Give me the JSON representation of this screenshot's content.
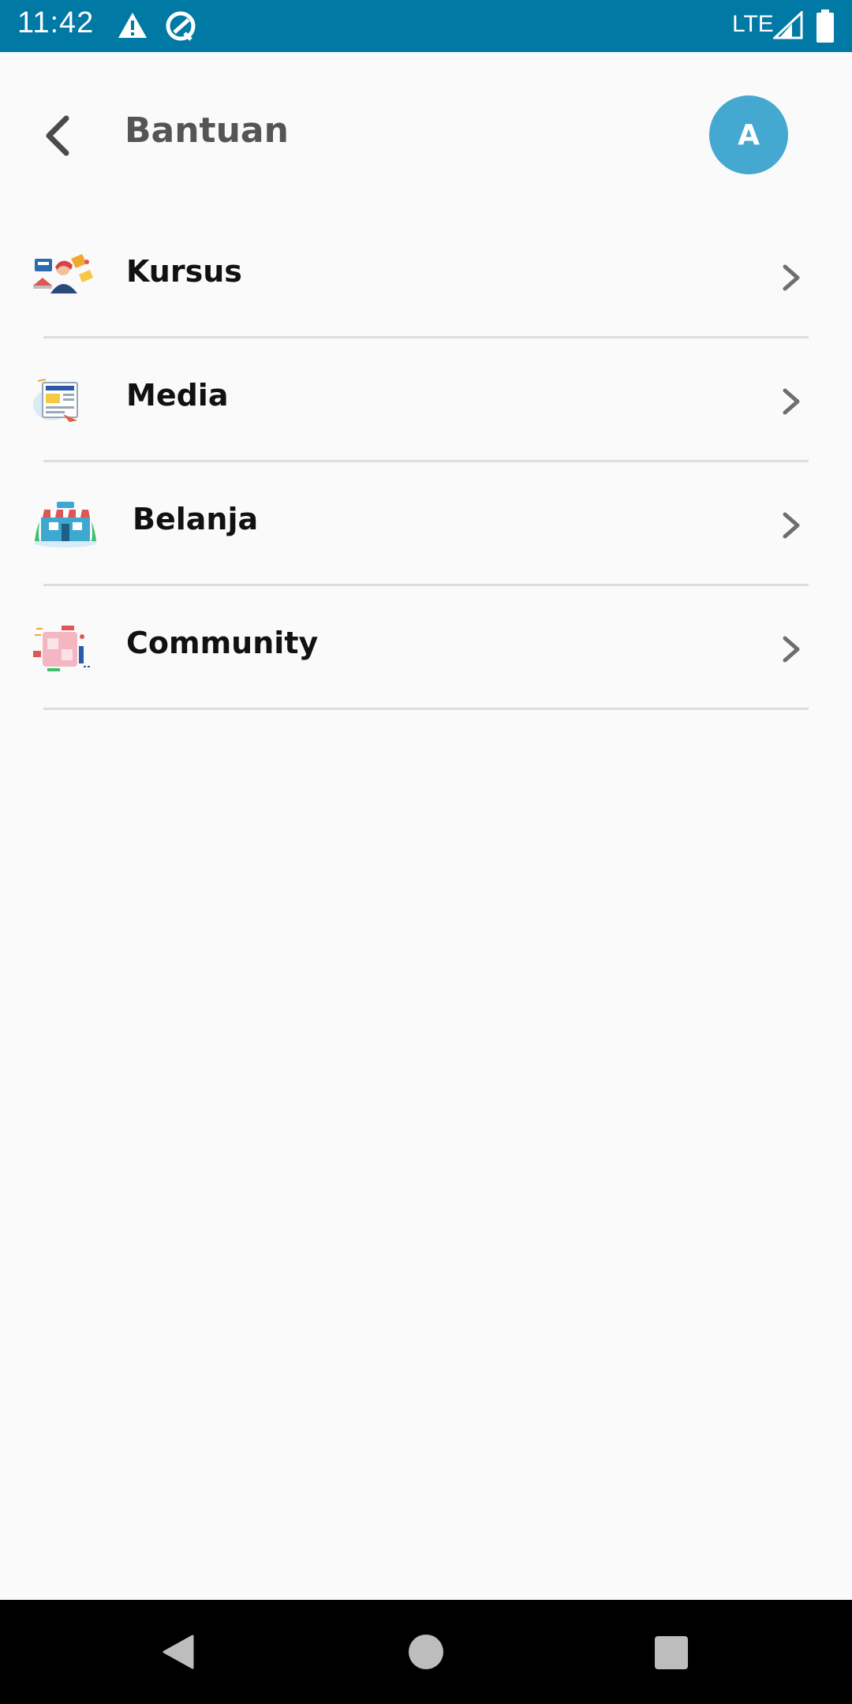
{
  "status_bar": {
    "time": "11:42",
    "network": "LTE",
    "icons": [
      "alert-icon",
      "sync-icon",
      "signal-icon",
      "battery-icon"
    ],
    "background": "#0079a5"
  },
  "header": {
    "title": "Bantuan",
    "back_icon": "arrow-left-icon",
    "avatar_initial": "A",
    "avatar_color": "#44a8d0"
  },
  "menu": {
    "items": [
      {
        "label": "Kursus",
        "icon": "course-illustration-icon"
      },
      {
        "label": "Media",
        "icon": "media-illustration-icon"
      },
      {
        "label": "Belanja",
        "icon": "shop-illustration-icon"
      },
      {
        "label": "Community",
        "icon": "community-illustration-icon"
      }
    ]
  },
  "nav_bar": {
    "icons": [
      "nav-back-icon",
      "nav-home-icon",
      "nav-recents-icon"
    ]
  }
}
